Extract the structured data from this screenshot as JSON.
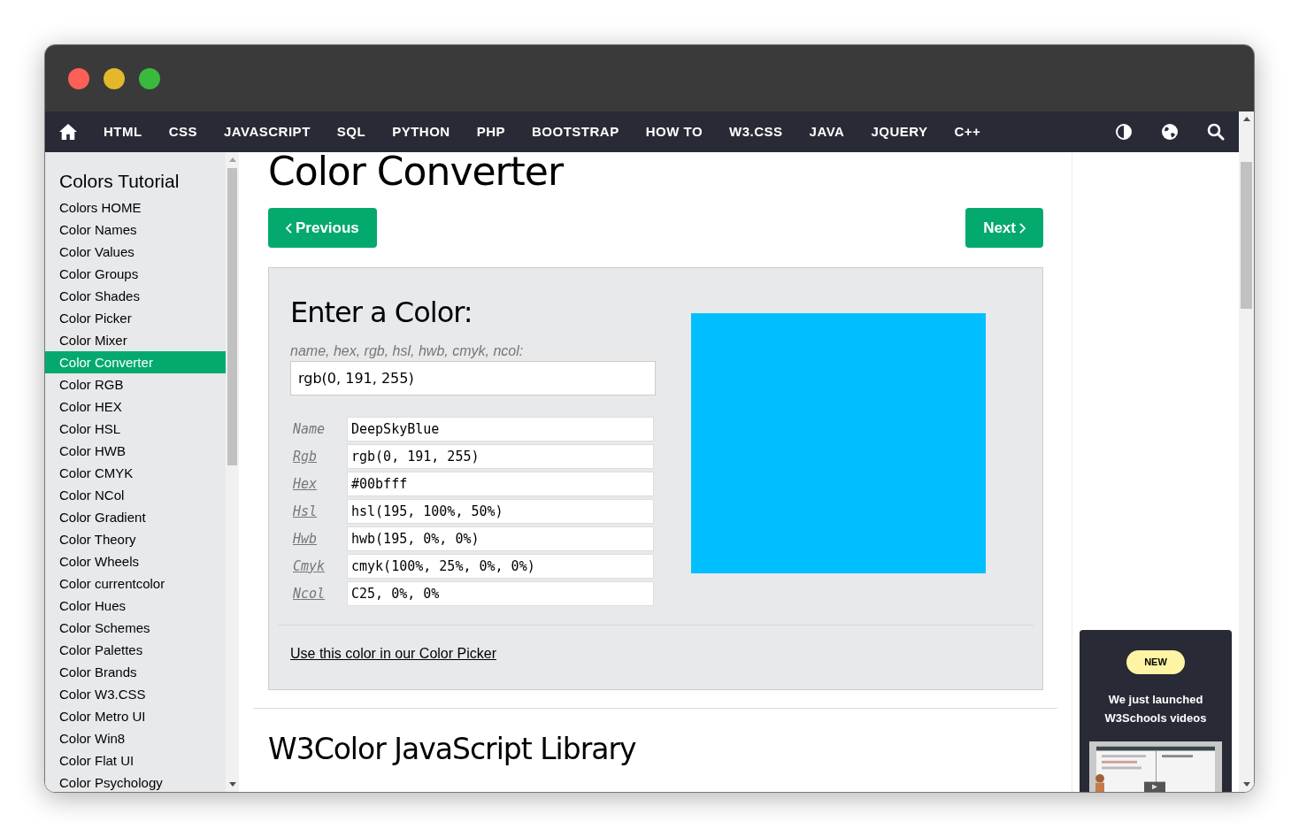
{
  "nav": {
    "items": [
      "HTML",
      "CSS",
      "JAVASCRIPT",
      "SQL",
      "PYTHON",
      "PHP",
      "BOOTSTRAP",
      "HOW TO",
      "W3.CSS",
      "JAVA",
      "JQUERY",
      "C++"
    ]
  },
  "sidebar": {
    "title": "Colors Tutorial",
    "items": [
      {
        "label": "Colors HOME",
        "selected": false
      },
      {
        "label": "Color Names",
        "selected": false
      },
      {
        "label": "Color Values",
        "selected": false
      },
      {
        "label": "Color Groups",
        "selected": false
      },
      {
        "label": "Color Shades",
        "selected": false
      },
      {
        "label": "Color Picker",
        "selected": false
      },
      {
        "label": "Color Mixer",
        "selected": false
      },
      {
        "label": "Color Converter",
        "selected": true
      },
      {
        "label": "Color RGB",
        "selected": false
      },
      {
        "label": "Color HEX",
        "selected": false
      },
      {
        "label": "Color HSL",
        "selected": false
      },
      {
        "label": "Color HWB",
        "selected": false
      },
      {
        "label": "Color CMYK",
        "selected": false
      },
      {
        "label": "Color NCol",
        "selected": false
      },
      {
        "label": "Color Gradient",
        "selected": false
      },
      {
        "label": "Color Theory",
        "selected": false
      },
      {
        "label": "Color Wheels",
        "selected": false
      },
      {
        "label": "Color currentcolor",
        "selected": false
      },
      {
        "label": "Color Hues",
        "selected": false
      },
      {
        "label": "Color Schemes",
        "selected": false
      },
      {
        "label": "Color Palettes",
        "selected": false
      },
      {
        "label": "Color Brands",
        "selected": false
      },
      {
        "label": "Color W3.CSS",
        "selected": false
      },
      {
        "label": "Color Metro UI",
        "selected": false
      },
      {
        "label": "Color Win8",
        "selected": false
      },
      {
        "label": "Color Flat UI",
        "selected": false
      },
      {
        "label": "Color Psychology",
        "selected": false
      }
    ]
  },
  "main": {
    "title": "Color Converter",
    "previous_button": "Previous",
    "next_button": "Next",
    "converter": {
      "heading": "Enter a Color:",
      "hint": "name, hex, rgb, hsl, hwb, cmyk, ncol:",
      "input_value": "rgb(0, 191, 255)",
      "rows": [
        {
          "label": "Name",
          "link": false,
          "value": "DeepSkyBlue"
        },
        {
          "label": "Rgb",
          "link": true,
          "value": "rgb(0, 191, 255)"
        },
        {
          "label": "Hex",
          "link": true,
          "value": "#00bfff"
        },
        {
          "label": "Hsl",
          "link": true,
          "value": "hsl(195, 100%, 50%)"
        },
        {
          "label": "Hwb",
          "link": true,
          "value": "hwb(195, 0%, 0%)"
        },
        {
          "label": "Cmyk",
          "link": true,
          "value": "cmyk(100%, 25%, 0%, 0%)"
        },
        {
          "label": "Ncol",
          "link": true,
          "value": "C25, 0%, 0%"
        }
      ],
      "picker_link": "Use this color in our Color Picker"
    },
    "section_heading": "W3Color JavaScript Library"
  },
  "ad": {
    "badge": "NEW",
    "text": "We just launched W3Schools videos"
  }
}
